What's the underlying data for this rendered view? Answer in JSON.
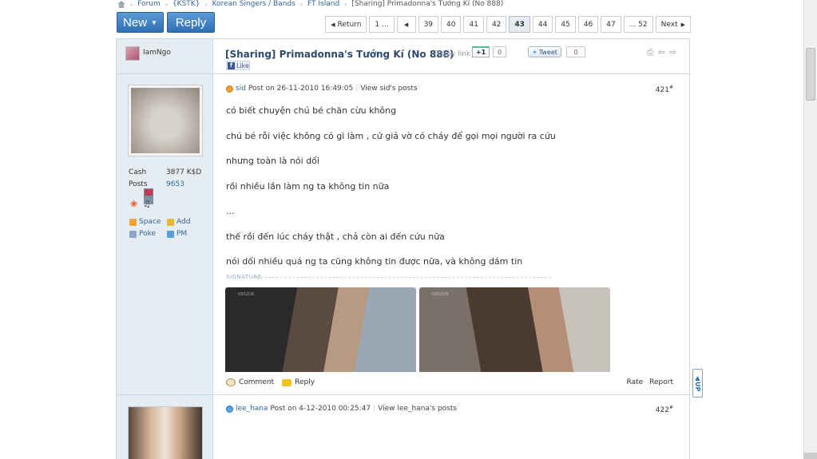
{
  "breadcrumb": [
    "Forum",
    "{KSTK}",
    "Korean Singers / Bands",
    "FT Island",
    "[Sharing] Primadonna's Tướng Kí (No 888)"
  ],
  "actions": {
    "new_label": "New",
    "reply_label": "Reply"
  },
  "pagination": {
    "return_label": "Return",
    "items": [
      "1 ...",
      "39",
      "40",
      "41",
      "42",
      "43",
      "44",
      "45",
      "46",
      "47",
      "... 52"
    ],
    "current": "43",
    "next_label": "Next"
  },
  "thread": {
    "author": "IamNgo",
    "title": "[Sharing] Primadonna's Tướng Kí (No 888)",
    "copy_link": "[Copy link]",
    "gplus_label": "+1",
    "gplus_count": "0",
    "tweet_label": "Tweet",
    "tweet_count": "0",
    "fb_like": "Like"
  },
  "posts": [
    {
      "author": "sid",
      "post_on": "Post on 26-11-2010 16:49:05",
      "view_posts": "View sid's posts",
      "number": "421",
      "profile": {
        "cash_label": "Cash",
        "cash_value": "3877 K$D",
        "posts_label": "Posts",
        "posts_value": "9653"
      },
      "links": [
        "Space",
        "Add",
        "Poke",
        "PM"
      ],
      "lines": [
        "có biết chuyện chú bé chăn cừu không",
        "chú bé rỗi việc không có gì làm , cứ giả vờ có cháy để gọi mọi người ra cứu",
        "nhưng toàn là nói dối",
        "rồi nhiều lần làm ng ta không tin nữa",
        "...",
        "thế rồi đến lúc cháy thật , chả còn ai đến cứu nữa",
        "nói dối nhiều quá ng ta cũng không tin được nữa, và không dám tin"
      ],
      "signature_label": "SIGNATURE",
      "photo_watermarks": [
        "KBS2DB",
        "KBS2DB"
      ],
      "comment_label": "Comment",
      "reply_label": "Reply",
      "rate_label": "Rate",
      "report_label": "Report"
    },
    {
      "author": "lee_hana",
      "post_on": "Post on 4-12-2010 00:25:47",
      "view_posts": "View lee_hana's posts",
      "number": "422"
    }
  ],
  "up_label": "UP"
}
